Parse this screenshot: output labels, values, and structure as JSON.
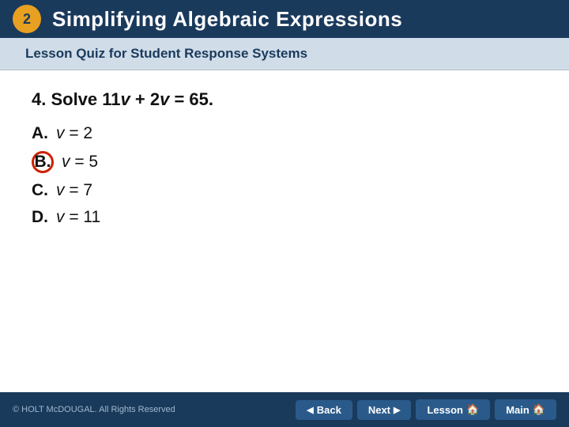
{
  "header": {
    "number": "2",
    "title": "Simplifying Algebraic Expressions"
  },
  "subtitle": {
    "text": "Lesson Quiz for Student Response Systems"
  },
  "question": {
    "label": "4. Solve 11v + 2v = 65.",
    "options": [
      {
        "id": "A",
        "text": "v = 2",
        "selected": false
      },
      {
        "id": "B",
        "text": "v = 5",
        "selected": true
      },
      {
        "id": "C",
        "text": "v = 7",
        "selected": false
      },
      {
        "id": "D",
        "text": "v = 11",
        "selected": false
      }
    ]
  },
  "footer": {
    "copyright": "© HOLT McDOUGAL. All Rights Reserved",
    "buttons": {
      "back": "Back",
      "next": "Next",
      "lesson": "Lesson",
      "main": "Main"
    }
  }
}
